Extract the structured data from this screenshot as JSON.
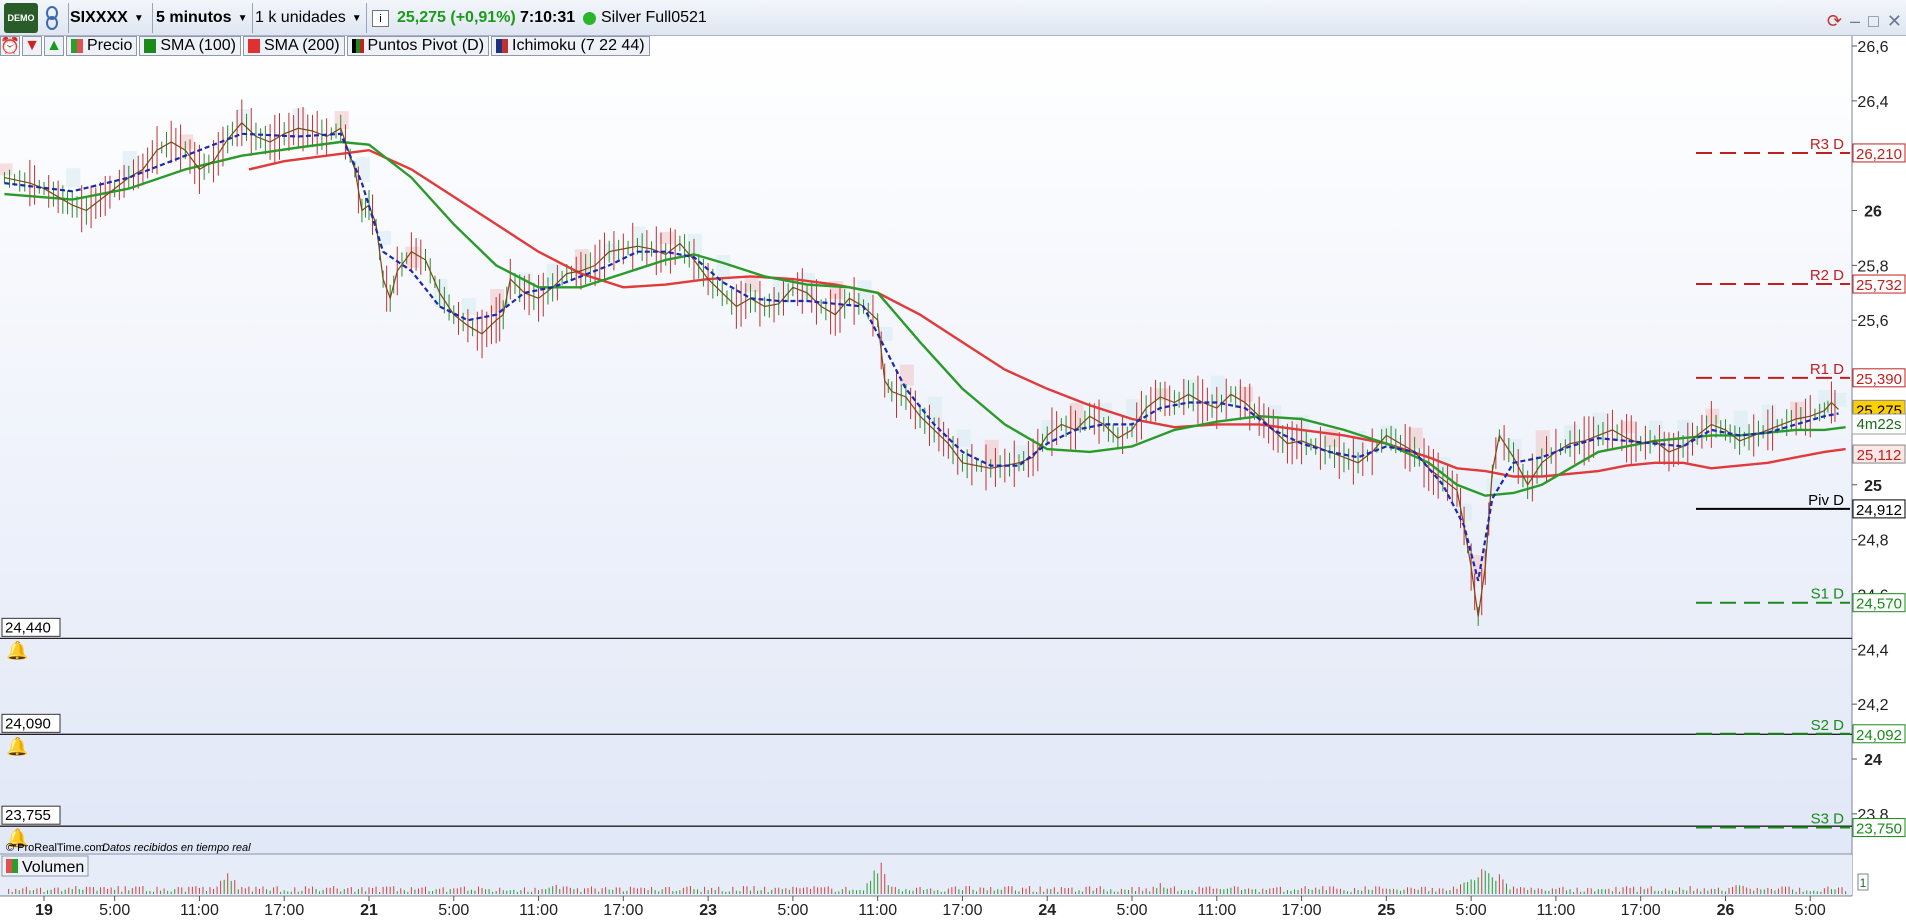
{
  "toolbar": {
    "demo_badge": "DEMO",
    "ticker": "SIXXXX",
    "timeframe": "5 minutos",
    "units": "1 k unidades",
    "info_icon": "i",
    "last_price": "25,275 (+0,91%)",
    "time": "7:10:31",
    "feed": "Silver Full0521"
  },
  "indicators": [
    {
      "label": "Precio",
      "color": "#e05050"
    },
    {
      "label": "SMA (100)",
      "color": "#1a8a1a"
    },
    {
      "label": "SMA (200)",
      "color": "#e03030"
    },
    {
      "label": "Puntos Pivot (D)",
      "color": "#1a6a1a"
    },
    {
      "label": "Ichimoku (7 22 44)",
      "color": "#203080"
    }
  ],
  "volume_label": "Volumen",
  "volume_axis_label": "1",
  "footer": {
    "source": "© ProRealTime.com",
    "realtime": "Datos recibidos en tiempo real"
  },
  "alert_boxes": [
    "24,440",
    "24,090",
    "23,755"
  ],
  "countdown": "4m22s",
  "chart_data": {
    "type": "line",
    "ylim": [
      23.7,
      26.65
    ],
    "y_ticks": [
      {
        "v": 26.6,
        "label": "26,6",
        "bold": false
      },
      {
        "v": 26.4,
        "label": "26,4",
        "bold": false
      },
      {
        "v": 26.0,
        "label": "26",
        "bold": true
      },
      {
        "v": 25.8,
        "label": "25,8",
        "bold": false
      },
      {
        "v": 25.6,
        "label": "25,6",
        "bold": false
      },
      {
        "v": 25.0,
        "label": "25",
        "bold": true
      },
      {
        "v": 24.8,
        "label": "24,8",
        "bold": false
      },
      {
        "v": 24.6,
        "label": "24,6",
        "bold": false
      },
      {
        "v": 24.4,
        "label": "24,4",
        "bold": false
      },
      {
        "v": 24.2,
        "label": "24,2",
        "bold": false
      },
      {
        "v": 24.0,
        "label": "24",
        "bold": true
      },
      {
        "v": 23.8,
        "label": "23,8",
        "bold": false
      }
    ],
    "x_ticks": [
      {
        "t": 0.0,
        "label": "19",
        "bold": true
      },
      {
        "t": 5.0,
        "label": "5:00",
        "bold": false
      },
      {
        "t": 11.0,
        "label": "11:00",
        "bold": false
      },
      {
        "t": 17.0,
        "label": "17:00",
        "bold": false
      },
      {
        "t": 23.0,
        "label": "21",
        "bold": true
      },
      {
        "t": 29.0,
        "label": "5:00",
        "bold": false
      },
      {
        "t": 35.0,
        "label": "11:00",
        "bold": false
      },
      {
        "t": 41.0,
        "label": "17:00",
        "bold": false
      },
      {
        "t": 47.0,
        "label": "23",
        "bold": true
      },
      {
        "t": 53.0,
        "label": "5:00",
        "bold": false
      },
      {
        "t": 59.0,
        "label": "11:00",
        "bold": false
      },
      {
        "t": 65.0,
        "label": "17:00",
        "bold": false
      },
      {
        "t": 71.0,
        "label": "24",
        "bold": true
      },
      {
        "t": 77.0,
        "label": "5:00",
        "bold": false
      },
      {
        "t": 83.0,
        "label": "11:00",
        "bold": false
      },
      {
        "t": 89.0,
        "label": "17:00",
        "bold": false
      },
      {
        "t": 95.0,
        "label": "25",
        "bold": true
      },
      {
        "t": 101.0,
        "label": "5:00",
        "bold": false
      },
      {
        "t": 107.0,
        "label": "11:00",
        "bold": false
      },
      {
        "t": 113.0,
        "label": "17:00",
        "bold": false
      },
      {
        "t": 119.0,
        "label": "26",
        "bold": true
      },
      {
        "t": 125.0,
        "label": "5:00",
        "bold": false
      }
    ],
    "xlim": [
      -2.8,
      129.5
    ],
    "price_series": [
      [
        -2.8,
        26.12
      ],
      [
        -1,
        26.1
      ],
      [
        0,
        26.08
      ],
      [
        1,
        26.05
      ],
      [
        2,
        26.02
      ],
      [
        3,
        26.0
      ],
      [
        4,
        26.04
      ],
      [
        5,
        26.08
      ],
      [
        6,
        26.12
      ],
      [
        7,
        26.15
      ],
      [
        8,
        26.22
      ],
      [
        9,
        26.25
      ],
      [
        10,
        26.22
      ],
      [
        11,
        26.15
      ],
      [
        12,
        26.18
      ],
      [
        13,
        26.26
      ],
      [
        14,
        26.32
      ],
      [
        15,
        26.27
      ],
      [
        16,
        26.25
      ],
      [
        17,
        26.28
      ],
      [
        18,
        26.3
      ],
      [
        19,
        26.29
      ],
      [
        20,
        26.27
      ],
      [
        21,
        26.3
      ],
      [
        22,
        26.15
      ],
      [
        22.5,
        26.0
      ],
      [
        23,
        26.02
      ],
      [
        23.5,
        25.95
      ],
      [
        24,
        25.75
      ],
      [
        24.5,
        25.68
      ],
      [
        25,
        25.78
      ],
      [
        26,
        25.85
      ],
      [
        27,
        25.82
      ],
      [
        28,
        25.7
      ],
      [
        29,
        25.62
      ],
      [
        30,
        25.58
      ],
      [
        31,
        25.55
      ],
      [
        32,
        25.6
      ],
      [
        32.5,
        25.62
      ],
      [
        33,
        25.75
      ],
      [
        34,
        25.7
      ],
      [
        35,
        25.68
      ],
      [
        36,
        25.72
      ],
      [
        37,
        25.77
      ],
      [
        38,
        25.78
      ],
      [
        39,
        25.8
      ],
      [
        40,
        25.85
      ],
      [
        41,
        25.86
      ],
      [
        42,
        25.87
      ],
      [
        43,
        25.86
      ],
      [
        44,
        25.84
      ],
      [
        45,
        25.88
      ],
      [
        46,
        25.82
      ],
      [
        47,
        25.75
      ],
      [
        48,
        25.7
      ],
      [
        49,
        25.65
      ],
      [
        50,
        25.68
      ],
      [
        51,
        25.65
      ],
      [
        52,
        25.66
      ],
      [
        53,
        25.72
      ],
      [
        54,
        25.7
      ],
      [
        55,
        25.65
      ],
      [
        56,
        25.62
      ],
      [
        57,
        25.68
      ],
      [
        58,
        25.65
      ],
      [
        59,
        25.6
      ],
      [
        59.5,
        25.38
      ],
      [
        60,
        25.34
      ],
      [
        61,
        25.32
      ],
      [
        62,
        25.25
      ],
      [
        63,
        25.2
      ],
      [
        64,
        25.15
      ],
      [
        65,
        25.08
      ],
      [
        66,
        25.07
      ],
      [
        67,
        25.06
      ],
      [
        68,
        25.07
      ],
      [
        69,
        25.08
      ],
      [
        70,
        25.1
      ],
      [
        71,
        25.18
      ],
      [
        72,
        25.22
      ],
      [
        73,
        25.2
      ],
      [
        74,
        25.25
      ],
      [
        75,
        25.22
      ],
      [
        76,
        25.17
      ],
      [
        77,
        25.2
      ],
      [
        78,
        25.28
      ],
      [
        79,
        25.32
      ],
      [
        80,
        25.3
      ],
      [
        81,
        25.33
      ],
      [
        82,
        25.3
      ],
      [
        83,
        25.28
      ],
      [
        84,
        25.33
      ],
      [
        85,
        25.3
      ],
      [
        86,
        25.25
      ],
      [
        87,
        25.2
      ],
      [
        88,
        25.15
      ],
      [
        89,
        25.16
      ],
      [
        90,
        25.14
      ],
      [
        91,
        25.12
      ],
      [
        92,
        25.1
      ],
      [
        93,
        25.08
      ],
      [
        94,
        25.12
      ],
      [
        95,
        25.18
      ],
      [
        96,
        25.15
      ],
      [
        97,
        25.12
      ],
      [
        98,
        25.06
      ],
      [
        99,
        25.02
      ],
      [
        100,
        24.98
      ],
      [
        100.5,
        24.85
      ],
      [
        101,
        24.7
      ],
      [
        101.5,
        24.52
      ],
      [
        102,
        24.7
      ],
      [
        102.5,
        25.05
      ],
      [
        103,
        25.18
      ],
      [
        104,
        25.1
      ],
      [
        105,
        25.0
      ],
      [
        106,
        25.08
      ],
      [
        107,
        25.12
      ],
      [
        108,
        25.15
      ],
      [
        109,
        25.16
      ],
      [
        110,
        25.18
      ],
      [
        111,
        25.2
      ],
      [
        112,
        25.17
      ],
      [
        113,
        25.15
      ],
      [
        114,
        25.16
      ],
      [
        115,
        25.12
      ],
      [
        116,
        25.14
      ],
      [
        117,
        25.18
      ],
      [
        118,
        25.22
      ],
      [
        119,
        25.2
      ],
      [
        120,
        25.16
      ],
      [
        121,
        25.18
      ],
      [
        122,
        25.2
      ],
      [
        123,
        25.22
      ],
      [
        124,
        25.24
      ],
      [
        125,
        25.25
      ],
      [
        126,
        25.27
      ],
      [
        126.5,
        25.3
      ],
      [
        127,
        25.275
      ]
    ],
    "sma100": [
      [
        -2.8,
        26.06
      ],
      [
        2,
        26.04
      ],
      [
        6,
        26.08
      ],
      [
        10,
        26.15
      ],
      [
        14,
        26.2
      ],
      [
        18,
        26.23
      ],
      [
        21,
        26.25
      ],
      [
        23,
        26.24
      ],
      [
        26,
        26.12
      ],
      [
        29,
        25.95
      ],
      [
        32,
        25.8
      ],
      [
        35,
        25.72
      ],
      [
        38,
        25.72
      ],
      [
        41,
        25.77
      ],
      [
        44,
        25.82
      ],
      [
        46,
        25.84
      ],
      [
        48,
        25.81
      ],
      [
        51,
        25.76
      ],
      [
        54,
        25.73
      ],
      [
        57,
        25.72
      ],
      [
        59,
        25.7
      ],
      [
        62,
        25.52
      ],
      [
        65,
        25.35
      ],
      [
        68,
        25.22
      ],
      [
        71,
        25.13
      ],
      [
        74,
        25.12
      ],
      [
        77,
        25.14
      ],
      [
        80,
        25.2
      ],
      [
        83,
        25.23
      ],
      [
        86,
        25.25
      ],
      [
        89,
        25.24
      ],
      [
        92,
        25.2
      ],
      [
        95,
        25.15
      ],
      [
        98,
        25.08
      ],
      [
        100,
        25.0
      ],
      [
        102,
        24.96
      ],
      [
        104,
        24.97
      ],
      [
        106,
        25.0
      ],
      [
        108,
        25.06
      ],
      [
        110,
        25.12
      ],
      [
        112,
        25.14
      ],
      [
        114,
        25.16
      ],
      [
        116,
        25.17
      ],
      [
        118,
        25.18
      ],
      [
        120,
        25.18
      ],
      [
        122,
        25.19
      ],
      [
        124,
        25.2
      ],
      [
        126,
        25.2
      ],
      [
        127.5,
        25.21
      ]
    ],
    "sma200": [
      [
        14.5,
        26.15
      ],
      [
        17,
        26.18
      ],
      [
        20,
        26.2
      ],
      [
        23,
        26.22
      ],
      [
        26,
        26.15
      ],
      [
        29,
        26.05
      ],
      [
        32,
        25.95
      ],
      [
        35,
        25.85
      ],
      [
        38,
        25.77
      ],
      [
        41,
        25.72
      ],
      [
        44,
        25.73
      ],
      [
        47,
        25.75
      ],
      [
        50,
        25.76
      ],
      [
        53,
        25.75
      ],
      [
        56,
        25.73
      ],
      [
        59,
        25.7
      ],
      [
        62,
        25.62
      ],
      [
        65,
        25.52
      ],
      [
        68,
        25.42
      ],
      [
        71,
        25.35
      ],
      [
        74,
        25.29
      ],
      [
        77,
        25.24
      ],
      [
        80,
        25.21
      ],
      [
        83,
        25.22
      ],
      [
        86,
        25.22
      ],
      [
        89,
        25.2
      ],
      [
        92,
        25.18
      ],
      [
        95,
        25.15
      ],
      [
        98,
        25.1
      ],
      [
        100,
        25.06
      ],
      [
        102,
        25.05
      ],
      [
        104,
        25.03
      ],
      [
        106,
        25.03
      ],
      [
        108,
        25.04
      ],
      [
        110,
        25.05
      ],
      [
        112,
        25.07
      ],
      [
        114,
        25.08
      ],
      [
        116,
        25.08
      ],
      [
        118,
        25.06
      ],
      [
        120,
        25.07
      ],
      [
        122,
        25.08
      ],
      [
        124,
        25.1
      ],
      [
        126,
        25.12
      ],
      [
        127.5,
        25.13
      ]
    ],
    "kijun": [
      [
        -2.8,
        26.1
      ],
      [
        2,
        26.07
      ],
      [
        6,
        26.12
      ],
      [
        10,
        26.2
      ],
      [
        14,
        26.28
      ],
      [
        18,
        26.27
      ],
      [
        21,
        26.28
      ],
      [
        22.5,
        26.1
      ],
      [
        24,
        25.85
      ],
      [
        26,
        25.78
      ],
      [
        28,
        25.65
      ],
      [
        30,
        25.6
      ],
      [
        32,
        25.62
      ],
      [
        34,
        25.7
      ],
      [
        36,
        25.72
      ],
      [
        38,
        25.76
      ],
      [
        40,
        25.8
      ],
      [
        42,
        25.85
      ],
      [
        44,
        25.85
      ],
      [
        46,
        25.83
      ],
      [
        48,
        25.74
      ],
      [
        50,
        25.68
      ],
      [
        52,
        25.67
      ],
      [
        54,
        25.67
      ],
      [
        56,
        25.66
      ],
      [
        58,
        25.65
      ],
      [
        59.5,
        25.5
      ],
      [
        61,
        25.35
      ],
      [
        63,
        25.22
      ],
      [
        65,
        25.12
      ],
      [
        67,
        25.07
      ],
      [
        69,
        25.07
      ],
      [
        71,
        25.15
      ],
      [
        73,
        25.2
      ],
      [
        75,
        25.22
      ],
      [
        77,
        25.22
      ],
      [
        79,
        25.28
      ],
      [
        81,
        25.3
      ],
      [
        83,
        25.3
      ],
      [
        85,
        25.28
      ],
      [
        87,
        25.2
      ],
      [
        89,
        25.15
      ],
      [
        91,
        25.12
      ],
      [
        93,
        25.1
      ],
      [
        95,
        25.14
      ],
      [
        97,
        25.12
      ],
      [
        99,
        25.0
      ],
      [
        100.5,
        24.85
      ],
      [
        101.5,
        24.65
      ],
      [
        102.5,
        24.95
      ],
      [
        104,
        25.08
      ],
      [
        106,
        25.1
      ],
      [
        108,
        25.14
      ],
      [
        110,
        25.17
      ],
      [
        112,
        25.16
      ],
      [
        114,
        25.15
      ],
      [
        116,
        25.14
      ],
      [
        118,
        25.2
      ],
      [
        120,
        25.18
      ],
      [
        122,
        25.19
      ],
      [
        124,
        25.22
      ],
      [
        126,
        25.25
      ],
      [
        127,
        25.26
      ]
    ],
    "pivots": [
      {
        "name": "R3 D",
        "value": 26.21,
        "label": "26,210",
        "color": "#c02020",
        "style": "dashed"
      },
      {
        "name": "R2 D",
        "value": 25.732,
        "label": "25,732",
        "color": "#c02020",
        "style": "dashed"
      },
      {
        "name": "R1 D",
        "value": 25.39,
        "label": "25,390",
        "color": "#c02020",
        "style": "dashed"
      },
      {
        "name": "Piv D",
        "value": 24.912,
        "label": "24,912",
        "color": "#000000",
        "style": "solid"
      },
      {
        "name": "S1 D",
        "value": 24.57,
        "label": "24,570",
        "color": "#1a8a1a",
        "style": "dashed"
      },
      {
        "name": "S2 D",
        "value": 24.092,
        "label": "24,092",
        "color": "#1a8a1a",
        "style": "dashed"
      },
      {
        "name": "S3 D",
        "value": 23.75,
        "label": "23,750",
        "color": "#1a8a1a",
        "style": "dashed"
      }
    ],
    "price_markers": [
      {
        "value": 25.275,
        "label": "25,275",
        "bg": "#ffd000",
        "fg": "#000000"
      },
      {
        "value": 25.112,
        "label": "25,112",
        "bg": "#fce7e7",
        "fg": "#c02020"
      }
    ],
    "alert_lines": [
      24.44,
      24.09,
      23.755
    ],
    "volume_spikes": [
      [
        13,
        0.6
      ],
      [
        59,
        1.0
      ],
      [
        101,
        0.7
      ],
      [
        102,
        1.0
      ],
      [
        103,
        0.6
      ],
      [
        79,
        0.35
      ],
      [
        36,
        0.3
      ],
      [
        84,
        0.3
      ],
      [
        120,
        0.3
      ]
    ]
  }
}
